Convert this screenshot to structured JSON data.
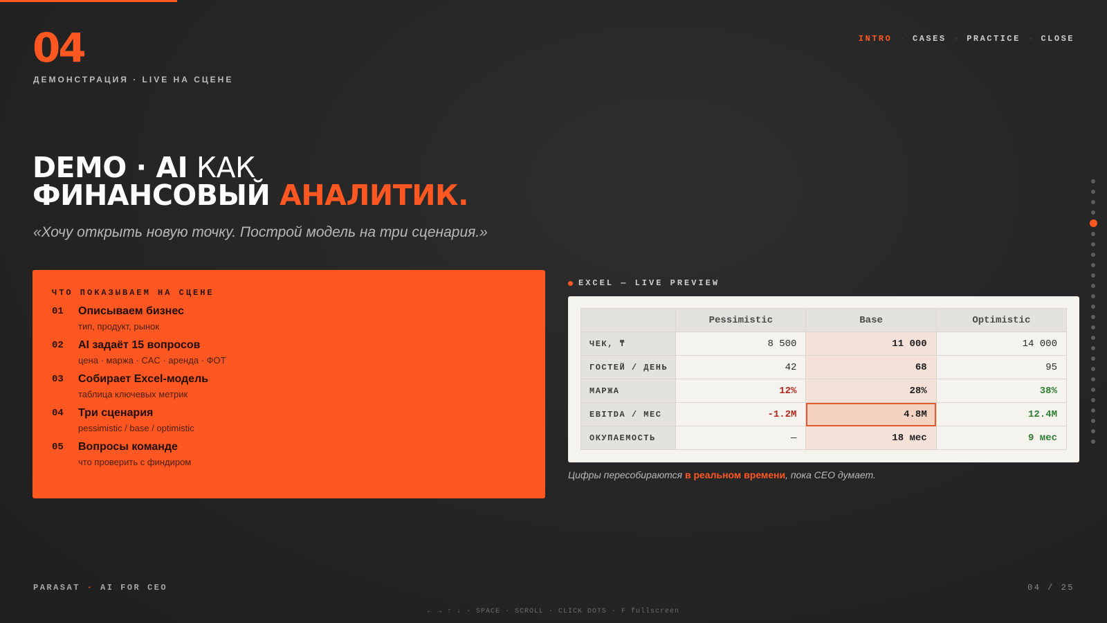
{
  "colors": {
    "accent": "#ff5722",
    "background": "#262626",
    "positive": "#2e7d32",
    "negative": "#b3261e"
  },
  "header": {
    "slide_number": "04",
    "section": "ДЕМОНСТРАЦИЯ · LIVE НА СЦЕНЕ",
    "progress": 0.16
  },
  "nav": {
    "items": [
      {
        "label": "INTRO",
        "active": true
      },
      {
        "label": "CASES",
        "active": false
      },
      {
        "label": "PRACTICE",
        "active": false
      },
      {
        "label": "CLOSE",
        "active": false
      }
    ],
    "separator": "·"
  },
  "title": {
    "part1_bold": "DEMO · AI",
    "part1_light": " КАК",
    "part2": "ФИНАНСОВЫЙ ",
    "part2_accent": "АНАЛИТИК."
  },
  "quote": "«Хочу открыть новую точку. Построй модель на три сценария.»",
  "steps_card": {
    "label": "ЧТО ПОКАЗЫВАЕМ НА СЦЕНЕ",
    "steps": [
      {
        "num": "01",
        "title": "Описываем бизнес",
        "sub": "тип, продукт, рынок"
      },
      {
        "num": "02",
        "title": "AI задаёт 15 вопросов",
        "sub": "цена · маржа · CAC · аренда · ФОТ"
      },
      {
        "num": "03",
        "title": "Собирает Excel-модель",
        "sub": "таблица ключевых метрик"
      },
      {
        "num": "04",
        "title": "Три сценария",
        "sub": "pessimistic / base / optimistic"
      },
      {
        "num": "05",
        "title": "Вопросы команде",
        "sub": "что проверить с финдиром"
      }
    ]
  },
  "excel": {
    "label": "EXCEL — LIVE PREVIEW",
    "columns": [
      "Pessimistic",
      "Base",
      "Optimistic"
    ],
    "rows": [
      {
        "label": "ЧЕК, ₸",
        "values": [
          "8 500",
          "11 000",
          "14 000"
        ],
        "tones": [
          "",
          "",
          ""
        ]
      },
      {
        "label": "ГОСТЕЙ / ДЕНЬ",
        "values": [
          "42",
          "68",
          "95"
        ],
        "tones": [
          "",
          "",
          ""
        ]
      },
      {
        "label": "МАРЖА",
        "values": [
          "12%",
          "28%",
          "38%"
        ],
        "tones": [
          "neg",
          "",
          "pos"
        ]
      },
      {
        "label": "EBITDA / МЕС",
        "values": [
          "-1.2M",
          "4.8M",
          "12.4M"
        ],
        "tones": [
          "neg",
          "",
          "pos"
        ]
      },
      {
        "label": "ОКУПАЕМОСТЬ",
        "values": [
          "—",
          "18 мес",
          "9 мес"
        ],
        "tones": [
          "",
          "",
          "pos"
        ]
      }
    ],
    "selected_cell": {
      "row": 3,
      "col": 1
    },
    "caption_pre": "Цифры пересобираются ",
    "caption_highlight": "в реальном времени",
    "caption_post": ", пока CEO думает."
  },
  "pager": {
    "total_dots": 26,
    "active_index": 4
  },
  "footer": {
    "brand_a": "PARASAT",
    "brand_dot": "·",
    "brand_b": "AI FOR CEO",
    "page_counter": "04 / 25",
    "shortcuts": "← → ↑ ↓ · SPACE · SCROLL · CLICK DOTS · F fullscreen"
  }
}
